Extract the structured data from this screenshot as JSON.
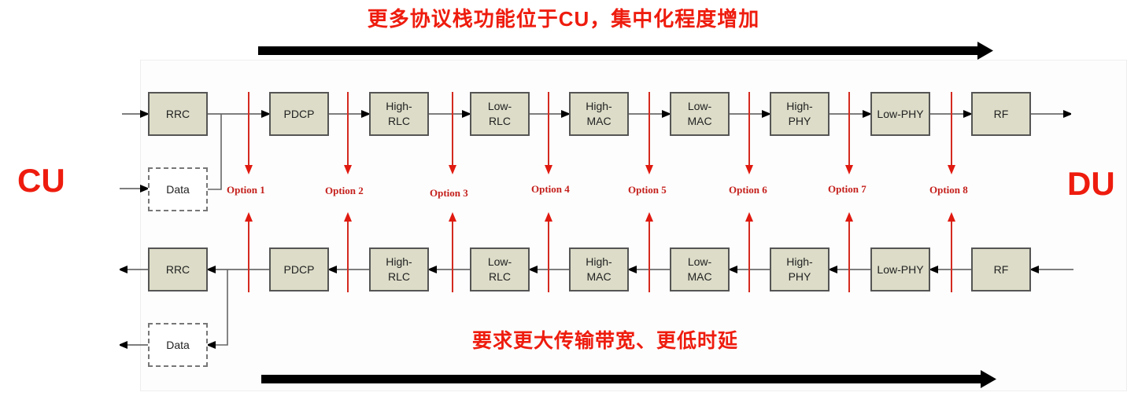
{
  "header": {
    "top_caption": "更多协议栈功能位于CU，集中化程度增加",
    "bottom_caption": "要求更大传输带宽、更低时延"
  },
  "sides": {
    "left": "CU",
    "right": "DU"
  },
  "downlink_blocks": [
    "RRC",
    "PDCP",
    "High-\nRLC",
    "Low-\nRLC",
    "High-\nMAC",
    "Low-\nMAC",
    "High-\nPHY",
    "Low-PHY",
    "RF"
  ],
  "uplink_blocks": [
    "RRC",
    "PDCP",
    "High-\nRLC",
    "Low-\nRLC",
    "High-\nMAC",
    "Low-\nMAC",
    "High-\nPHY",
    "Low-PHY",
    "RF"
  ],
  "data_block_label": "Data",
  "options": [
    "Option 1",
    "Option 2",
    "Option 3",
    "Option 4",
    "Option 5",
    "Option 6",
    "Option 7",
    "Option 8"
  ],
  "colors": {
    "accent_red": "#ee1c0e",
    "split_line_red": "#d42a20",
    "block_fill": "#dcdcc8",
    "arrow_black": "#000000"
  }
}
